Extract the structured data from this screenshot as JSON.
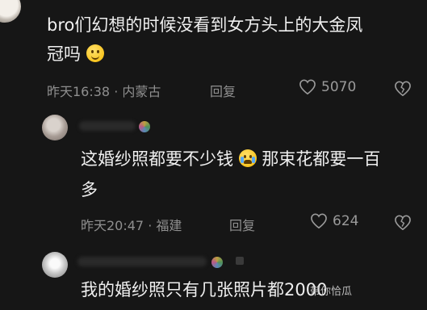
{
  "comments": [
    {
      "text_line1": "bro们幻想的时候没看到女方头上的大金凤",
      "text_line2": "冠吗",
      "emoji": "laughing-face",
      "time_location": "昨天16:38 · 内蒙古",
      "reply_label": "回复",
      "likes": "5070"
    },
    {
      "text_line1_a": "这婚纱照都要不少钱",
      "emoji": "crying-face",
      "text_line1_b": "那束花都要一百",
      "text_line2": "多",
      "time_location": "昨天20:47 · 福建",
      "reply_label": "回复",
      "likes": "624"
    },
    {
      "text_line1": "我的婚纱照只有几张照片都2000"
    }
  ],
  "watermark": {
    "badge": "",
    "text": "带你恰瓜"
  },
  "colors": {
    "background": "#161616",
    "text": "#efefef",
    "meta": "#8f8f8f"
  }
}
